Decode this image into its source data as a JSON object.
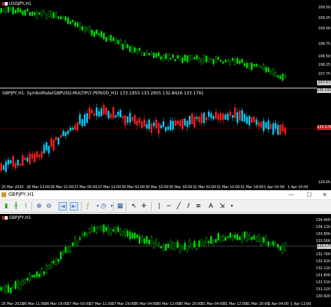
{
  "top_window": {
    "main_pane": {
      "title": "USDJPY,H1",
      "price_labels": [
        "109.50",
        "109.25",
        "109.00",
        "108.75",
        "108.50",
        "108.25",
        "107.75",
        "107.50"
      ],
      "current_price": "107.57",
      "colors": {
        "bull": "#00e000",
        "bear": "#00e000",
        "bg": "#000000"
      }
    },
    "indicator_pane": {
      "title": "GBPJPY,H1: SymbolRate(GBPUSD.MULTIPLY,PERIOD_H1) 133.1955 133.2955 132.8426 133.1791",
      "price_labels": [
        "135.101",
        "129.05"
      ],
      "current_price": "133.179",
      "colors": {
        "bull": "#ff2020",
        "bear": "#00d0ff",
        "level": "#cc0000"
      }
    },
    "time_labels": [
      "25 Mar 2020",
      "26 Mar 13:00",
      "26 Mar 21:00",
      "27 Mar 05:00",
      "27 Mar 13:00",
      "30 Mar 02:00",
      "30 Mar 10:00",
      "30 Mar 18:00",
      "31 Mar 02:00",
      "31 Mar 10:00",
      "31 Mar 18:00",
      "1 Apr 02:00",
      "1 Apr 10:00"
    ]
  },
  "sub_window": {
    "title": "GBPJPY,H1",
    "window_controls": {
      "minimize": "—",
      "maximize": "☐",
      "close": "✕"
    },
    "chart": {
      "title": "GBPJPY,H1",
      "price_labels": [
        "134.400",
        "134.110",
        "133.800",
        "133.500",
        "133.177",
        "132.700",
        "132.410",
        "132.110",
        "131.800",
        "131.510",
        "131.220",
        "130.920"
      ],
      "current_price": "133.177",
      "time_labels": [
        "25 Mar 2020",
        "26 Mar 11:00",
        "26 Mar 19:00",
        "27 Mar 03:00",
        "27 Mar 11:00",
        "27 Mar 19:00",
        "30 Mar 04:00",
        "30 Mar 12:00",
        "30 Mar 20:00",
        "31 Mar 04:00",
        "31 Mar 12:00",
        "31 Mar 20:00",
        "1 Apr 04:00",
        "1 Apr 12:00"
      ]
    }
  }
}
